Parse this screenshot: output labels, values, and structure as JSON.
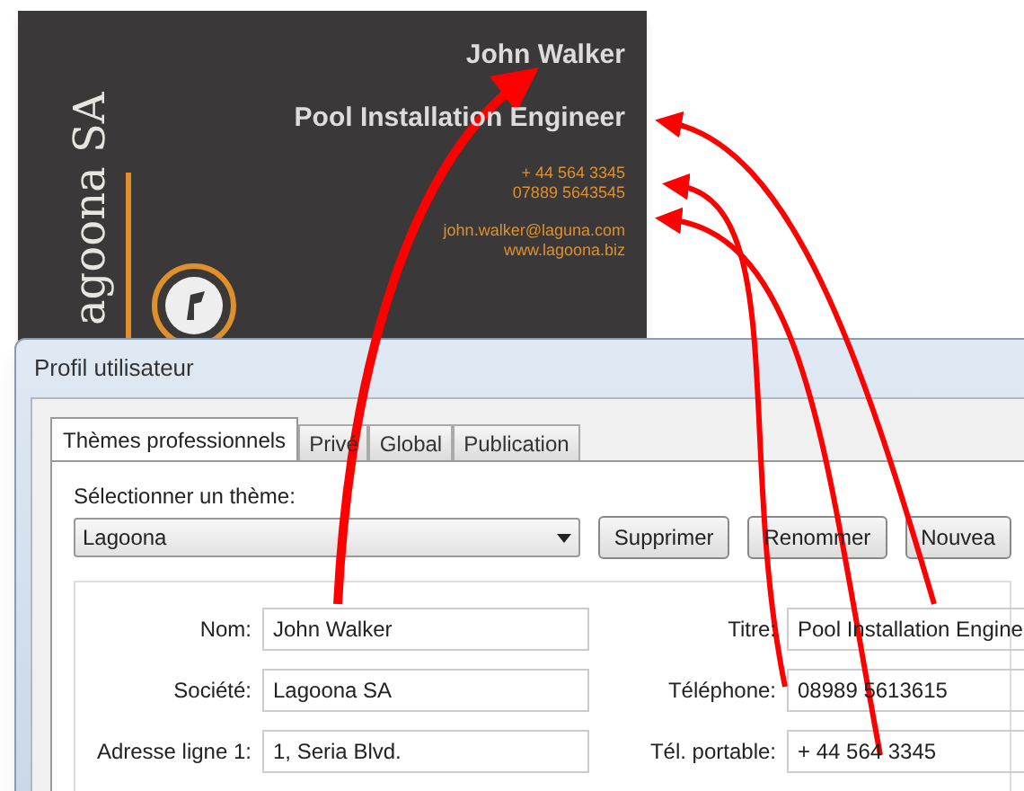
{
  "card": {
    "logo": "agoona SA",
    "name": "John Walker",
    "title": "Pool Installation Engineer",
    "phones": [
      "+ 44 564 3345",
      "07889 5643545"
    ],
    "contacts": [
      "john.walker@laguna.com",
      "www.lagoona.biz"
    ]
  },
  "dialog": {
    "title": "Profil utilisateur",
    "tabs": [
      {
        "label": "Thèmes professionnels",
        "selected": true
      },
      {
        "label": "Privé",
        "selected": false
      },
      {
        "label": "Global",
        "selected": false
      },
      {
        "label": "Publication",
        "selected": false
      }
    ],
    "theme_label": "Sélectionner un thème:",
    "theme_value": "Lagoona",
    "buttons": [
      "Supprimer",
      "Renommer",
      "Nouvea"
    ],
    "fields": [
      {
        "label": "Nom:",
        "value": "John Walker"
      },
      {
        "label": "Titre:",
        "value": "Pool Installation Engine"
      },
      {
        "label": "Société:",
        "value": "Lagoona SA"
      },
      {
        "label": "Téléphone:",
        "value": "08989 5613615"
      },
      {
        "label": "Adresse ligne 1:",
        "value": "1, Seria Blvd."
      },
      {
        "label": "Tél. portable:",
        "value": "+ 44 564 3345"
      }
    ]
  }
}
